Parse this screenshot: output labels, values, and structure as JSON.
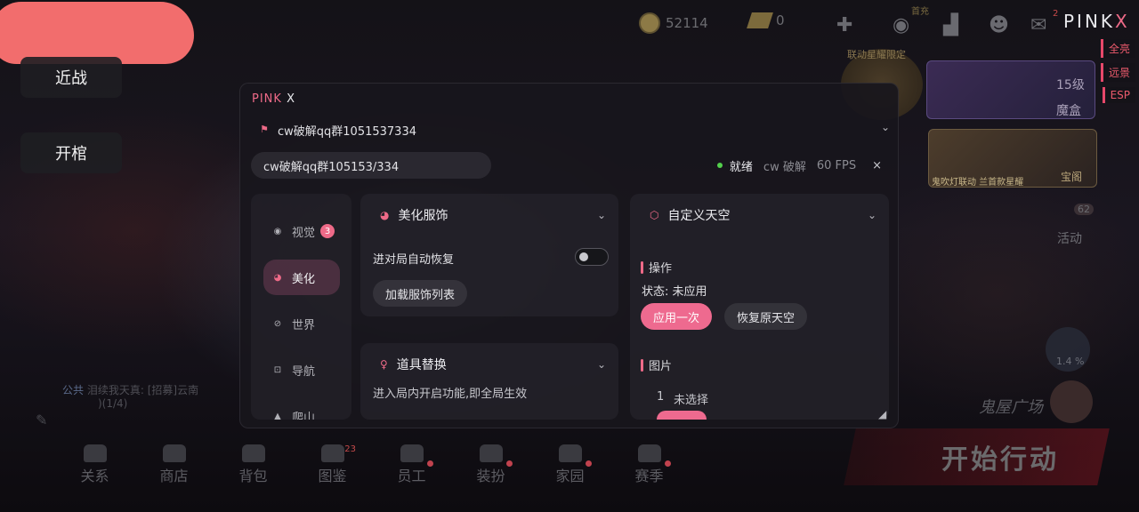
{
  "hud": {
    "currency1": "52114",
    "currency2": "0",
    "first_charge": "首充",
    "mail_count": "2",
    "logo_main": "PINK",
    "logo_accent": "X",
    "side_toggles": [
      "全亮",
      "远景",
      "ESP"
    ],
    "event1_label": "联动星耀限定",
    "event_level": "15级",
    "event_box": "魔盒",
    "event2_label": "鬼吹灯联动 兰首款星耀",
    "event2_side": "宝阁",
    "activity_label": "活动",
    "activity_count": "62",
    "progress_label": "1.4 %",
    "ghost_plaza": "鬼屋广场",
    "start_label": "开始行动"
  },
  "left": {
    "melee": "近战",
    "open_coffin": "开棺"
  },
  "chat": {
    "channel": "公共",
    "line1": "泪续我天真: [招募]云南",
    "line2": ")(1/4)"
  },
  "bottom_nav": [
    {
      "label": "关系",
      "dot": false,
      "num": ""
    },
    {
      "label": "商店",
      "dot": false,
      "num": ""
    },
    {
      "label": "背包",
      "dot": false,
      "num": ""
    },
    {
      "label": "图鉴",
      "dot": false,
      "num": "23"
    },
    {
      "label": "员工",
      "dot": true,
      "num": ""
    },
    {
      "label": "装扮",
      "dot": true,
      "num": ""
    },
    {
      "label": "家园",
      "dot": true,
      "num": ""
    },
    {
      "label": "赛季",
      "dot": true,
      "num": ""
    }
  ],
  "panel": {
    "title_main": "PINK",
    "title_accent": "X",
    "header_text": "cw破解qq群1051537334",
    "search_value": "cw破解qq群105153/334",
    "status_ready": "就绪",
    "status_name": "cw 破解",
    "status_fps": "60 FPS",
    "close_glyph": "×"
  },
  "sidebar": {
    "items": [
      {
        "label": "视觉",
        "badge": "3",
        "icon": "eye-icon"
      },
      {
        "label": "美化",
        "badge": "",
        "icon": "palette-icon",
        "active": true
      },
      {
        "label": "世界",
        "badge": "",
        "icon": "globe-icon"
      },
      {
        "label": "导航",
        "badge": "",
        "icon": "navigation-icon"
      },
      {
        "label": "爬山",
        "badge": "",
        "icon": "mountain-icon"
      }
    ]
  },
  "card_beautify": {
    "title": "美化服饰",
    "auto_restore_label": "进对局自动恢复",
    "load_list_button": "加载服饰列表"
  },
  "card_props": {
    "title": "道具替换",
    "desc": "进入局内开启功能,即全局生效"
  },
  "card_sky": {
    "title": "自定义天空",
    "section_ops": "操作",
    "status_text": "状态: 未应用",
    "apply_button": "应用一次",
    "restore_button": "恢复原天空",
    "section_image": "图片",
    "list_index": "1",
    "list_value": "未选择"
  },
  "colors": {
    "accent_pink": "#ee6a88",
    "ready_green": "#53d04c"
  }
}
